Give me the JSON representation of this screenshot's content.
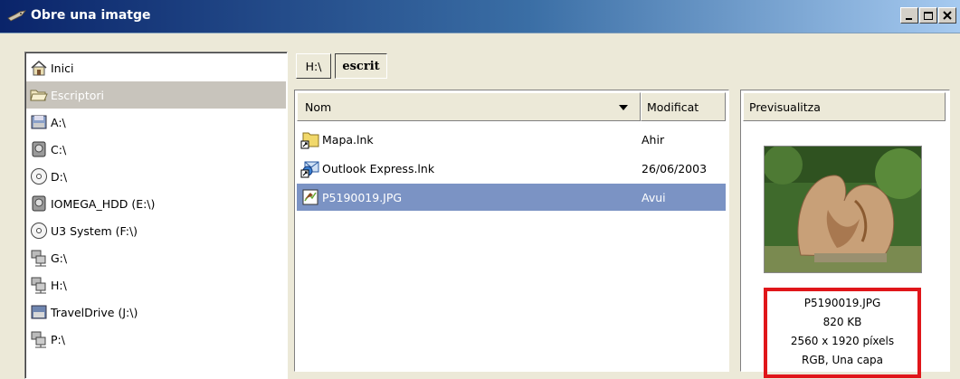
{
  "window": {
    "title": "Obre una imatge"
  },
  "places": [
    {
      "label": "Inici",
      "icon": "home-icon"
    },
    {
      "label": "Escriptori",
      "icon": "folder-open-icon",
      "selected": true
    },
    {
      "label": "A:\\",
      "icon": "floppy-drive-icon"
    },
    {
      "label": "C:\\",
      "icon": "hard-drive-icon"
    },
    {
      "label": "D:\\",
      "icon": "cd-drive-icon"
    },
    {
      "label": "IOMEGA_HDD (E:\\)",
      "icon": "hard-drive-icon"
    },
    {
      "label": "U3 System (F:\\)",
      "icon": "cd-drive-icon"
    },
    {
      "label": "G:\\",
      "icon": "network-drive-icon"
    },
    {
      "label": "H:\\",
      "icon": "network-drive-icon"
    },
    {
      "label": "TravelDrive (J:\\)",
      "icon": "removable-drive-icon"
    },
    {
      "label": "P:\\",
      "icon": "network-drive-icon"
    }
  ],
  "path": {
    "root": "H:\\",
    "current": "escrit"
  },
  "filelist": {
    "col_name": "Nom",
    "col_modified": "Modificat",
    "files": [
      {
        "name": "Mapa.lnk",
        "modified": "Ahir",
        "icon": "folder-shortcut-icon"
      },
      {
        "name": "Outlook Express.lnk",
        "modified": "26/06/2003",
        "icon": "outlook-shortcut-icon"
      },
      {
        "name": "P5190019.JPG",
        "modified": "Avui",
        "icon": "image-file-icon",
        "selected": true
      }
    ]
  },
  "preview": {
    "header": "Previsualitza",
    "filename": "P5190019.JPG",
    "size": "820 KB",
    "dimensions": "2560 x 1920 píxels",
    "layers": "RGB, Una capa"
  },
  "colors": {
    "selection": "#7b93c4",
    "highlight_border": "#e0161a",
    "titlebar": "#0a246a"
  }
}
